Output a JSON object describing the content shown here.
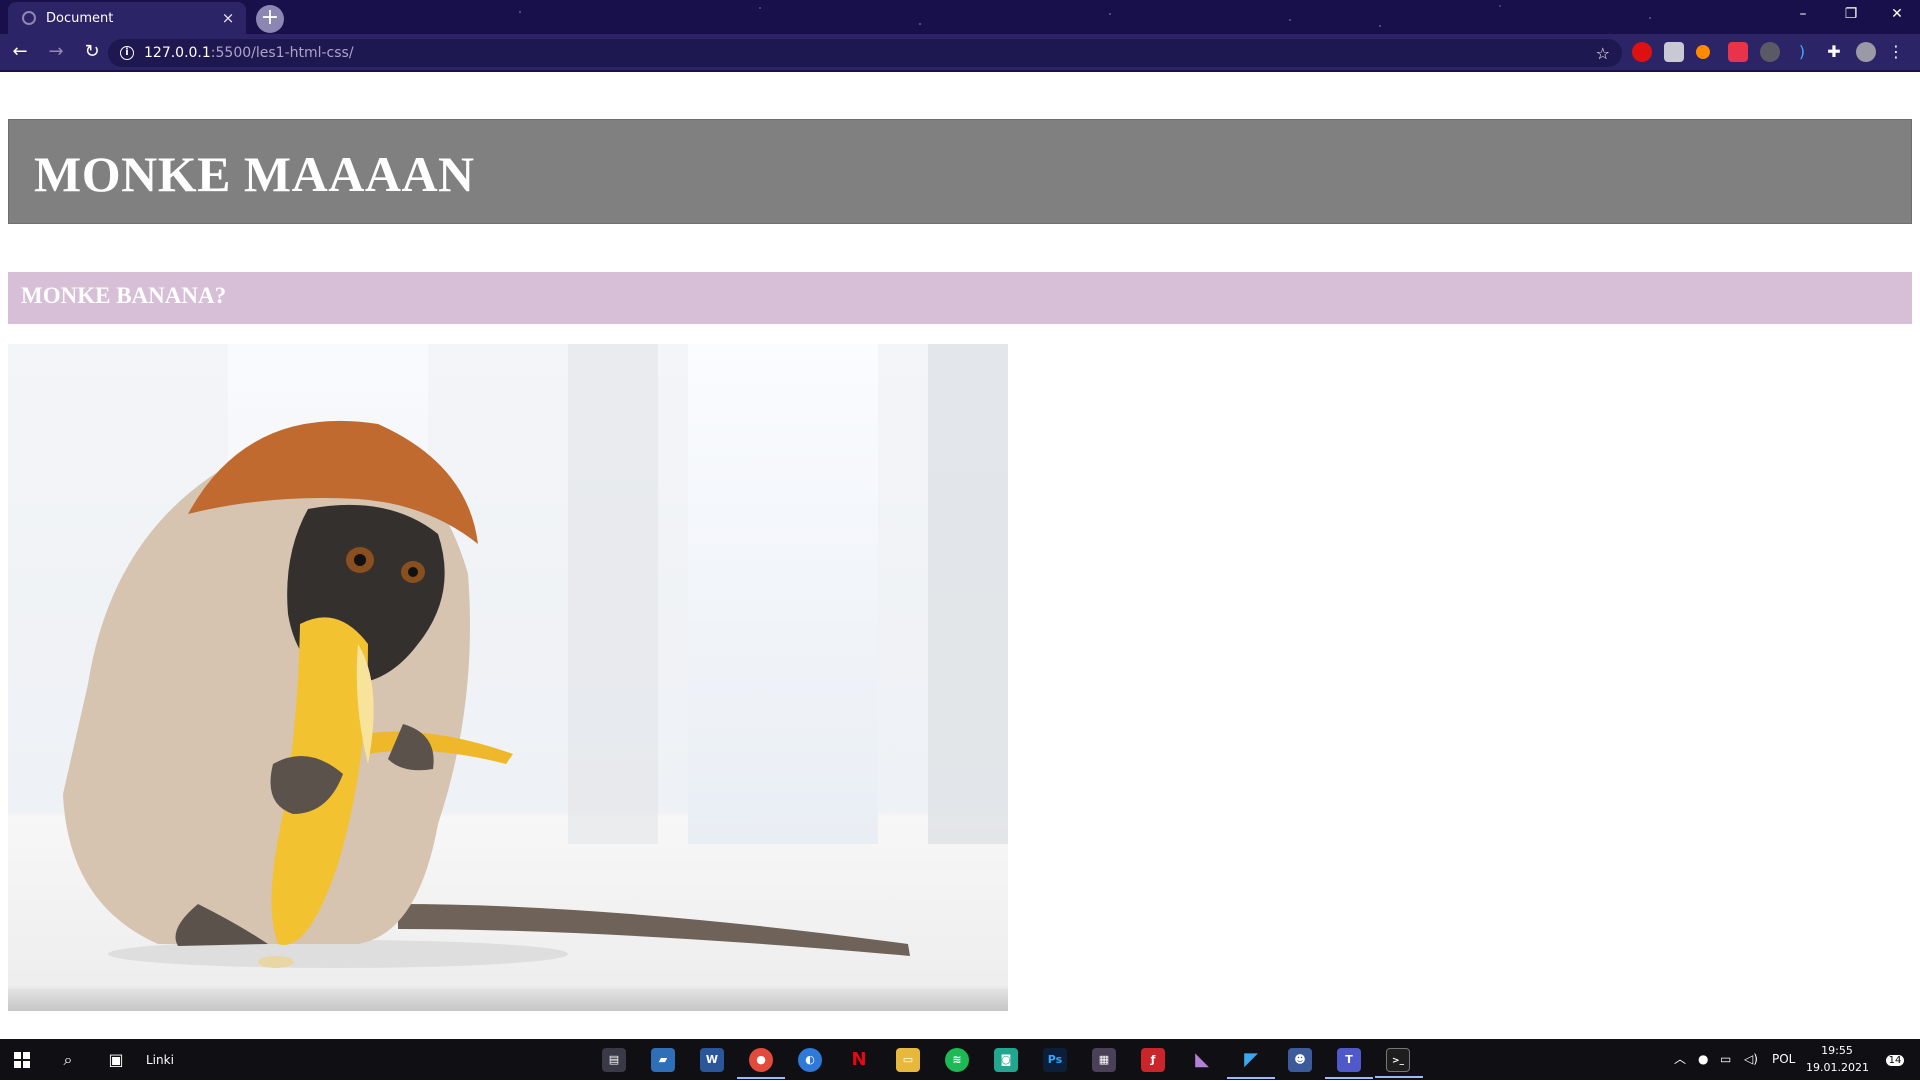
{
  "browser": {
    "tab_title": "Document",
    "tab_close": "×",
    "new_tab": "+",
    "url_host": "127.0.0.1",
    "url_path": ":5500/les1-html-css/",
    "info_icon": "i",
    "back": "←",
    "forward": "→",
    "reload": "↻",
    "star": "☆",
    "menu": "⋮",
    "window_minimize": "–",
    "window_restore": "❐",
    "window_close": "✕"
  },
  "page": {
    "header_title": "MONKE MAAAAN",
    "section_title": "MONKE BANANA?",
    "image_subject": "monkey eating a banana"
  },
  "taskbar": {
    "links_label": "Linki",
    "language": "POL",
    "time": "19:55",
    "date": "19.01.2021",
    "notifications_count": "14"
  },
  "colors": {
    "tabstrip": "#17104a",
    "toolbar": "#2b2466",
    "header_bg": "#808080",
    "section_bg": "#d8bfd8",
    "taskbar": "#101014"
  }
}
